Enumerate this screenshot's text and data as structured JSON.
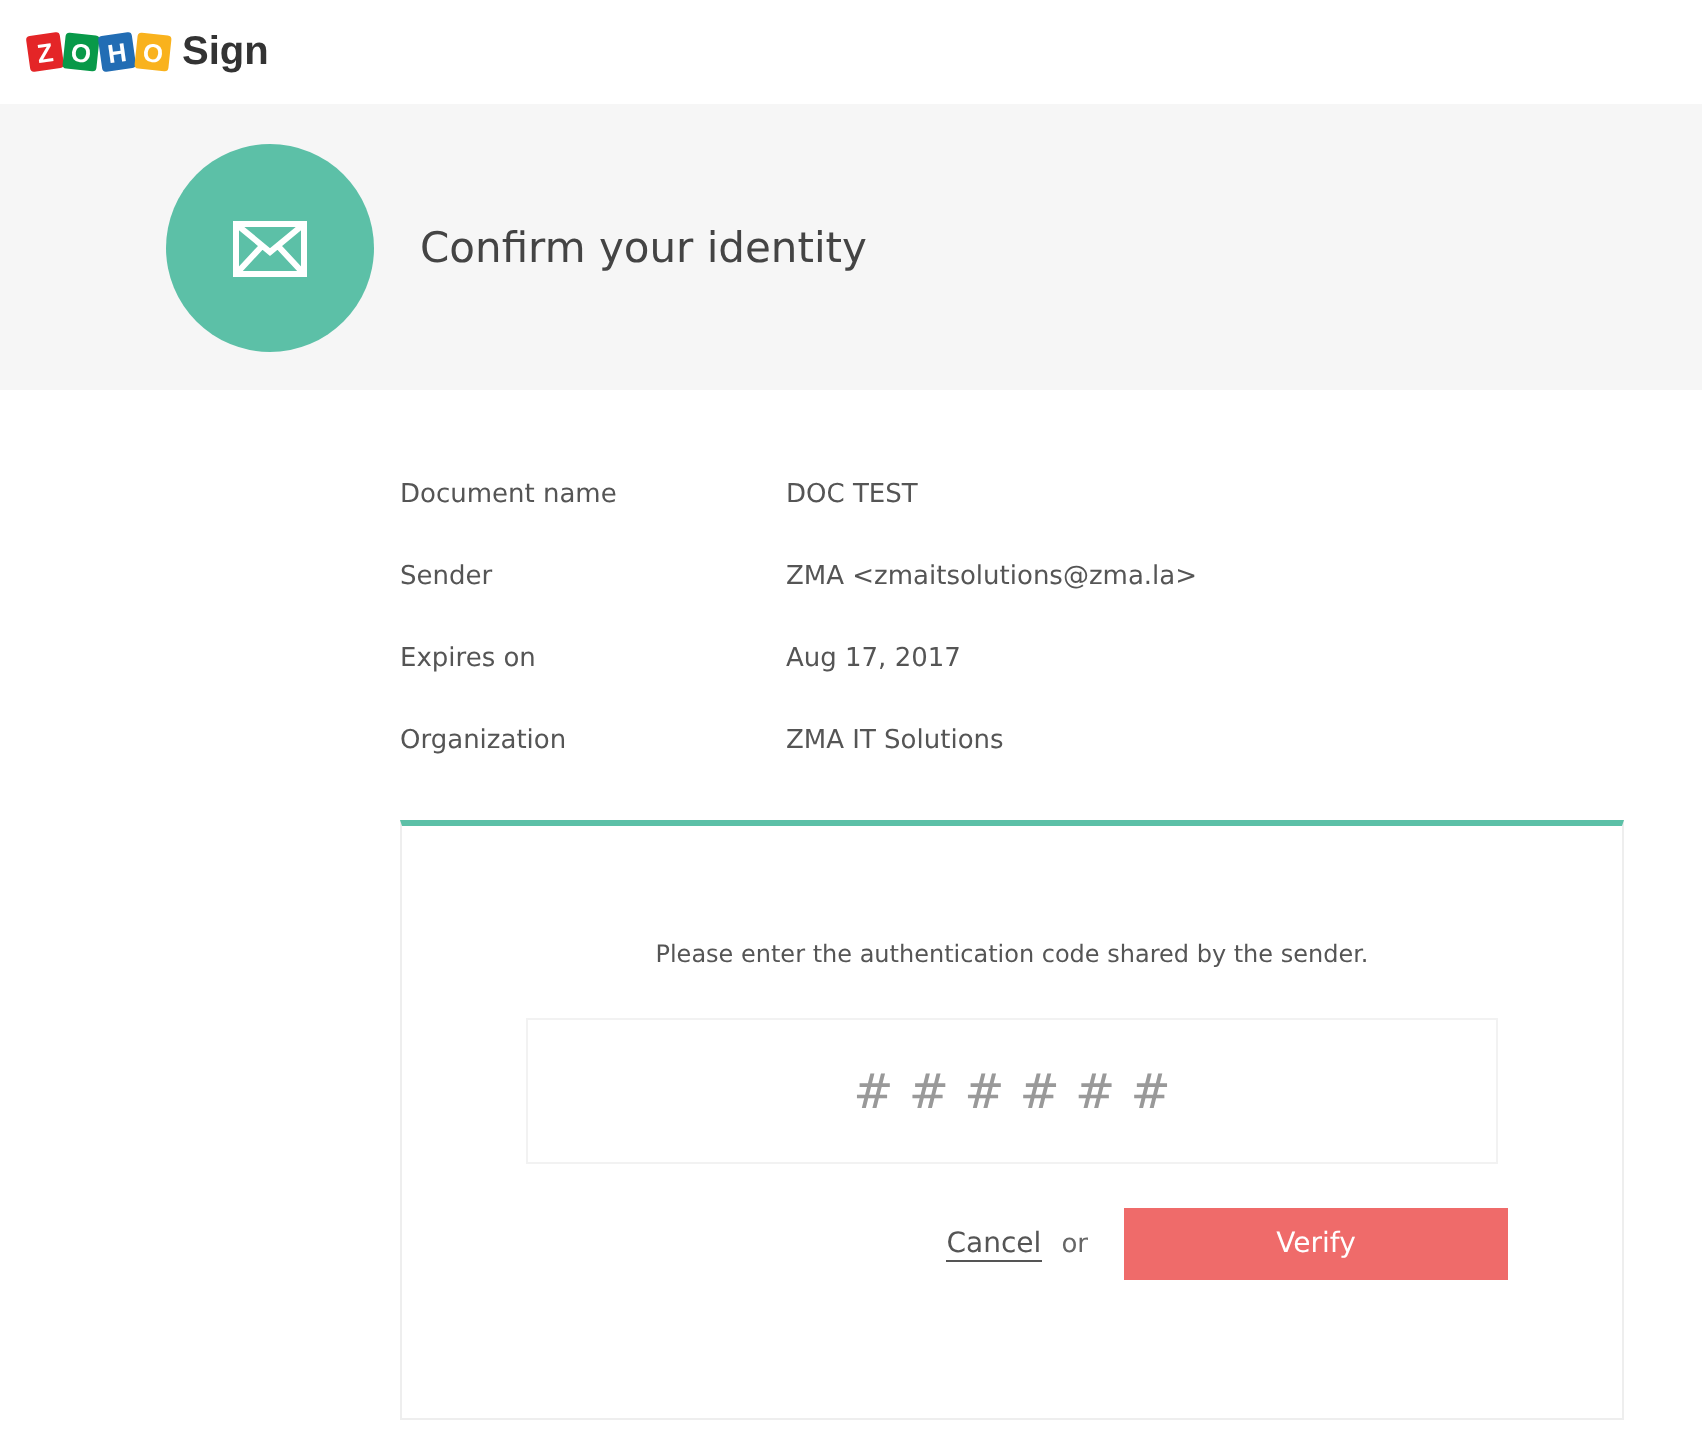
{
  "logo": {
    "tiles": [
      {
        "letter": "Z",
        "color": "#e42527"
      },
      {
        "letter": "O",
        "color": "#089949"
      },
      {
        "letter": "H",
        "color": "#226db4"
      },
      {
        "letter": "O",
        "color": "#f9b21d"
      }
    ],
    "product": "Sign"
  },
  "banner": {
    "title": "Confirm your identity"
  },
  "details": [
    {
      "label": "Document name",
      "value": "DOC TEST"
    },
    {
      "label": "Sender",
      "value": "ZMA <zmaitsolutions@zma.la>"
    },
    {
      "label": "Expires on",
      "value": "Aug 17, 2017"
    },
    {
      "label": "Organization",
      "value": "ZMA IT Solutions"
    }
  ],
  "verification": {
    "prompt": "Please enter the authentication code shared by the sender.",
    "code_field": {
      "placeholder": "# # # # # #"
    },
    "cancel": "Cancel",
    "separator": "or",
    "verify": "Verify"
  }
}
